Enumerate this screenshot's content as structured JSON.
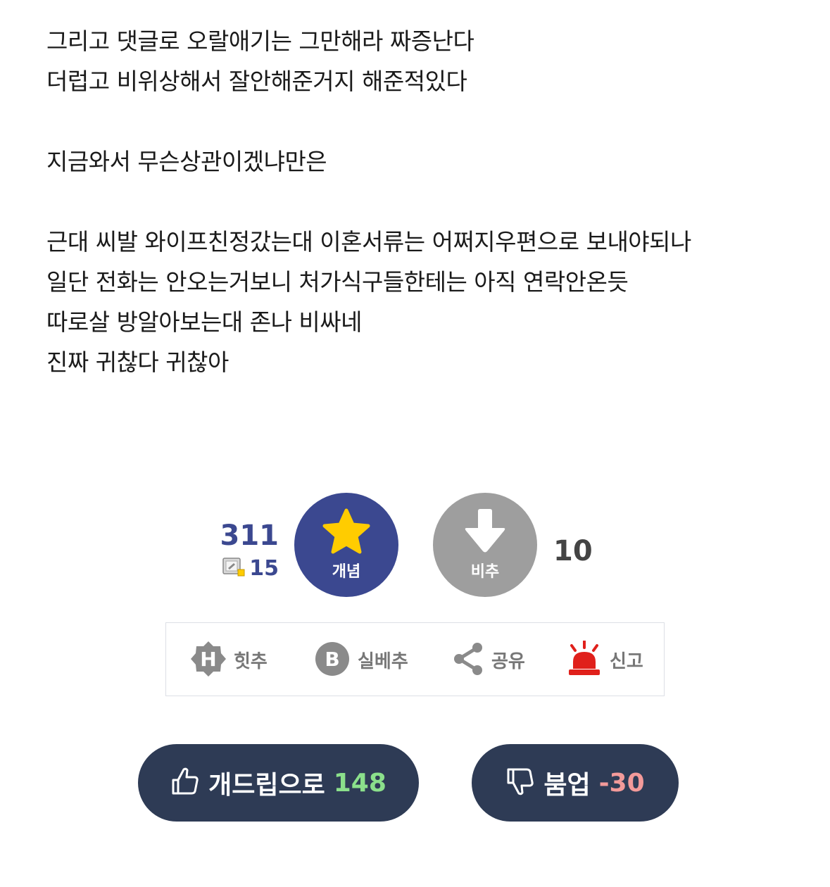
{
  "post": {
    "lines": [
      "그리고 댓글로 오랄애기는 그만해라 짜증난다",
      "더럽고 비위상해서 잘안해준거지 해준적있다",
      "",
      "지금와서 무슨상관이겠냐만은",
      "",
      "근대 씨발 와이프친정갔는대 이혼서류는 어쩌지우편으로 보내야되나",
      "일단 전화는 안오는거보니 처가식구들한테는 아직 연락안온듯",
      "따로살 방알아보는대 존나 비싸네",
      "진짜 귀찮다 귀찮아"
    ]
  },
  "recommend": {
    "up_count": "311",
    "fixed_count": "15",
    "up_label": "개념",
    "down_label": "비추",
    "down_count": "10",
    "up_color": "#3b4890",
    "down_color": "#9e9e9e",
    "star_color": "#ffcc00"
  },
  "actions": {
    "hit": "힛추",
    "best": "실베추",
    "share": "공유",
    "report": "신고",
    "report_color": "#e0201b"
  },
  "votes": {
    "like_label": "개드립으로",
    "like_count": "148",
    "like_count_color": "#8be08b",
    "dislike_label": "붐업",
    "dislike_count": "-30",
    "dislike_count_color": "#f39a9a"
  }
}
